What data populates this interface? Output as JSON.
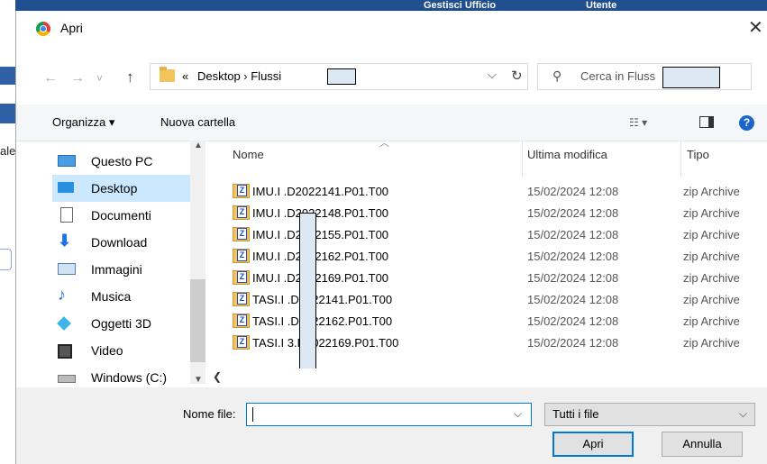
{
  "background_app": {
    "left_text": "ale",
    "top_texts": [
      "Gestisci Ufficio",
      "Utente"
    ]
  },
  "dialog": {
    "title": "Apri",
    "nav": {
      "back": "←",
      "forward": "→",
      "recent": "˅",
      "up": "↑"
    },
    "address": {
      "prefix": "«",
      "path": "Desktop › Flussi"
    },
    "search": {
      "placeholder": "Cerca in Fluss"
    },
    "toolbar": {
      "organize": "Organizza ▾",
      "new_folder": "Nuova cartella",
      "view": "☷ ▾",
      "help": "?"
    },
    "nav_pane": [
      {
        "label": "Questo PC",
        "icon": "computer-icon"
      },
      {
        "label": "Desktop",
        "icon": "desktop-folder-icon",
        "selected": true
      },
      {
        "label": "Documenti",
        "icon": "documents-icon"
      },
      {
        "label": "Download",
        "icon": "download-icon"
      },
      {
        "label": "Immagini",
        "icon": "pictures-icon"
      },
      {
        "label": "Musica",
        "icon": "music-icon"
      },
      {
        "label": "Oggetti 3D",
        "icon": "3d-objects-icon"
      },
      {
        "label": "Video",
        "icon": "video-icon"
      },
      {
        "label": "Windows (C:)",
        "icon": "drive-icon"
      }
    ],
    "columns": {
      "name": "Nome",
      "modified": "Ultima modifica",
      "type": "Tipo"
    },
    "files": [
      {
        "name": "IMU.I      .D2022141.P01.T00",
        "modified": "15/02/2024 12:08",
        "type": "zip Archive"
      },
      {
        "name": "IMU.I      .D2022148.P01.T00",
        "modified": "15/02/2024 12:08",
        "type": "zip Archive"
      },
      {
        "name": "IMU.I      .D2022155.P01.T00",
        "modified": "15/02/2024 12:08",
        "type": "zip Archive"
      },
      {
        "name": "IMU.I      .D2022162.P01.T00",
        "modified": "15/02/2024 12:08",
        "type": "zip Archive"
      },
      {
        "name": "IMU.I      .D2022169.P01.T00",
        "modified": "15/02/2024 12:08",
        "type": "zip Archive"
      },
      {
        "name": "TASI.I      .D2022141.P01.T00",
        "modified": "15/02/2024 12:08",
        "type": "zip Archive"
      },
      {
        "name": "TASI.I      .D2022162.P01.T00",
        "modified": "15/02/2024 12:08",
        "type": "zip Archive"
      },
      {
        "name": "TASI.I   3.D2022169.P01.T00",
        "modified": "15/02/2024 12:08",
        "type": "zip Archive"
      }
    ],
    "filename_label": "Nome file:",
    "filename_value": "",
    "filetype": "Tutti i file",
    "open_button": "Apri",
    "cancel_button": "Annulla"
  }
}
